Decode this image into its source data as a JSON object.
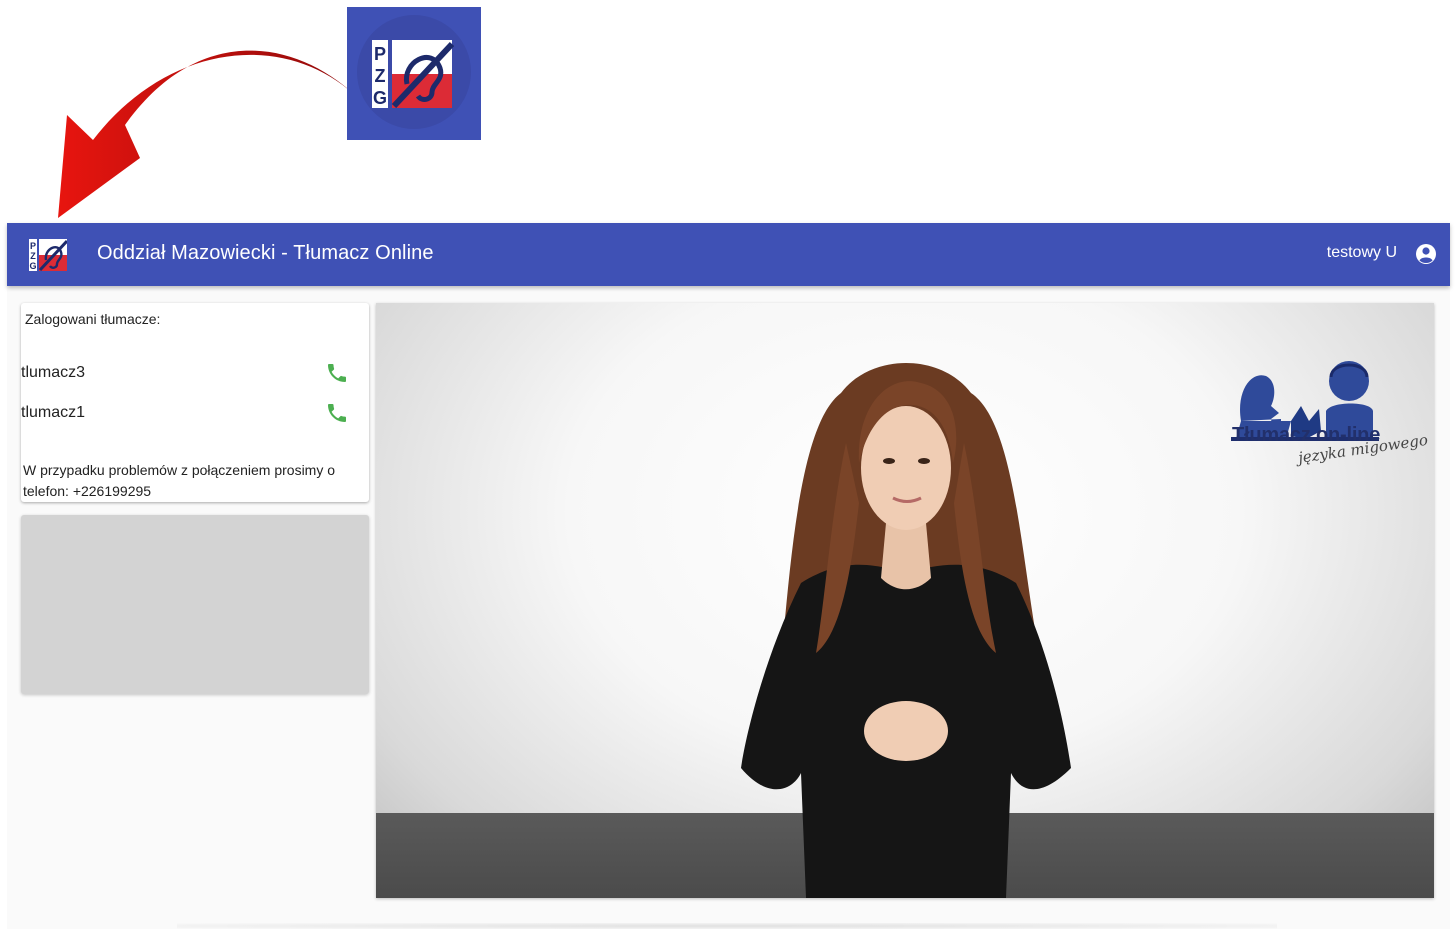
{
  "app": {
    "title": "Oddział Mazowiecki - Tłumacz Online",
    "user_name": "testowy U",
    "brand_color": "#3f51b5"
  },
  "logo": {
    "letters": [
      "P",
      "Z",
      "G"
    ]
  },
  "interpreters_panel": {
    "heading": "Zalogowani tłumacze:",
    "items": [
      {
        "name": "tlumacz3",
        "icon": "phone-icon",
        "icon_color": "#4caf50"
      },
      {
        "name": "tlumacz1",
        "icon": "phone-icon",
        "icon_color": "#4caf50"
      }
    ],
    "note": "W przypadku problemów z połączeniem prosimy o telefon: +226199295"
  },
  "video": {
    "brand_title": "Tłumacz on-line",
    "brand_subtitle": "języka migowego"
  },
  "icons": {
    "user": "account-circle-icon",
    "arrow": "red-curved-arrow"
  }
}
